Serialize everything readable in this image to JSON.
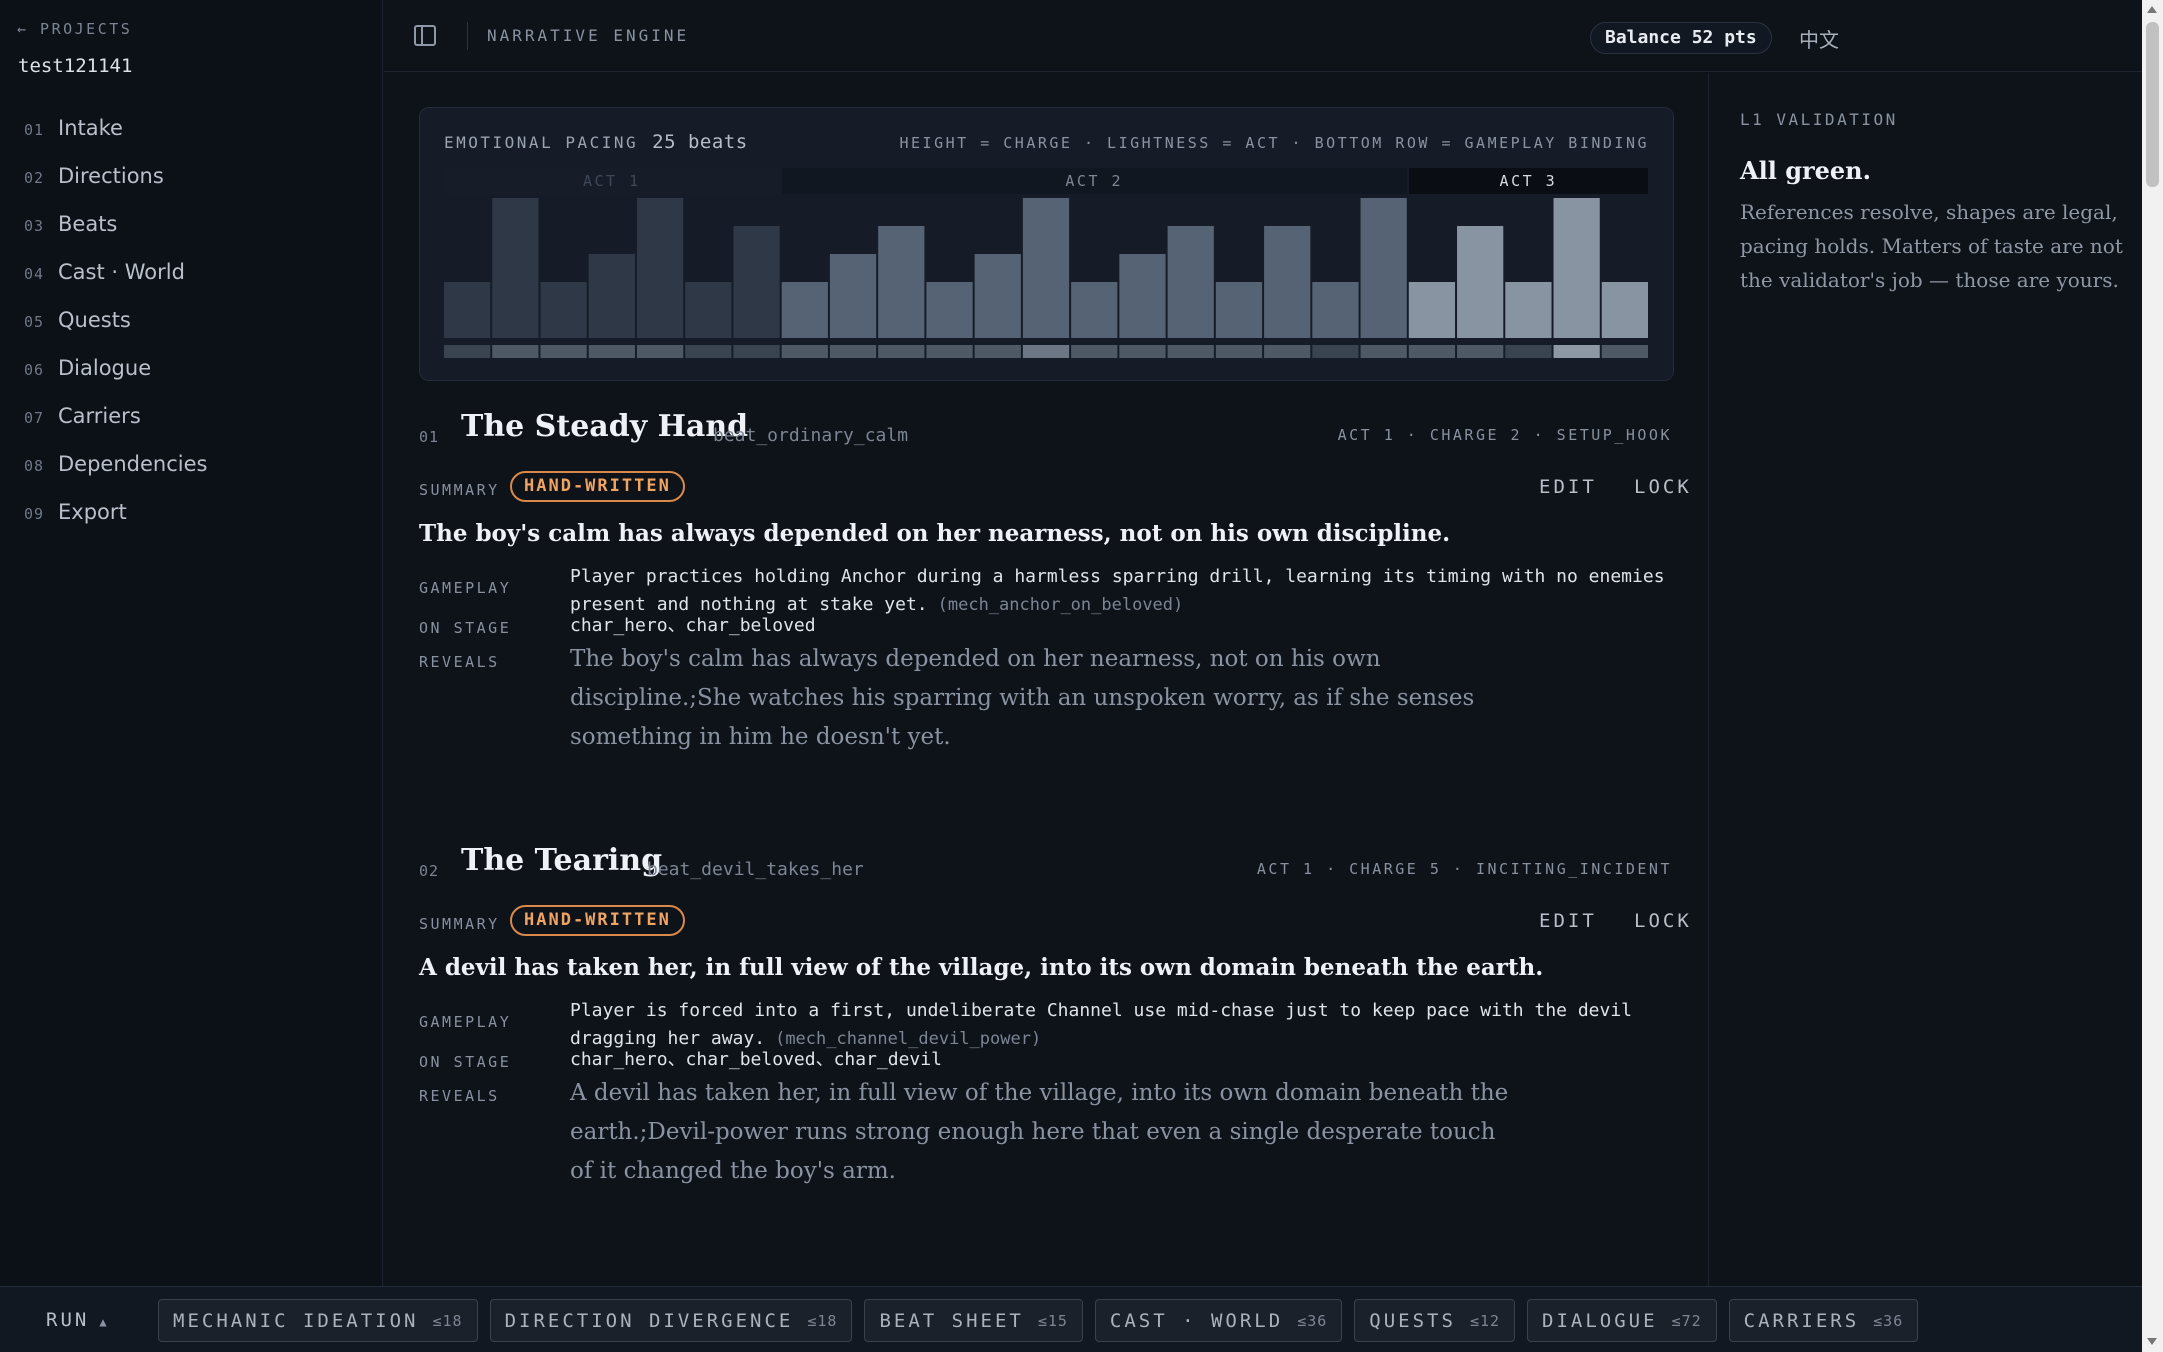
{
  "sidebar": {
    "back_label": "← PROJECTS",
    "project_name": "test121141",
    "items": [
      {
        "num": "01",
        "label": "Intake"
      },
      {
        "num": "02",
        "label": "Directions"
      },
      {
        "num": "03",
        "label": "Beats"
      },
      {
        "num": "04",
        "label": "Cast · World"
      },
      {
        "num": "05",
        "label": "Quests"
      },
      {
        "num": "06",
        "label": "Dialogue"
      },
      {
        "num": "07",
        "label": "Carriers"
      },
      {
        "num": "08",
        "label": "Dependencies"
      },
      {
        "num": "09",
        "label": "Export"
      }
    ]
  },
  "topbar": {
    "app_title": "NARRATIVE ENGINE",
    "balance": "Balance 52 pts",
    "lang_label": "中文"
  },
  "pacing": {
    "title": "EMOTIONAL PACING",
    "count": "25 beats",
    "legend": "HEIGHT = CHARGE · LIGHTNESS = ACT · BOTTOM ROW = GAMEPLAY BINDING",
    "acts": [
      {
        "label": "ACT 1",
        "beats": 7,
        "text_color": "#3f4857",
        "bg": "#161d28"
      },
      {
        "label": "ACT 2",
        "beats": 13,
        "text_color": "#7d8695",
        "bg": "#111720"
      },
      {
        "label": "ACT 3",
        "beats": 5,
        "text_color": "#d6dbe3",
        "bg": "#0a0e14"
      }
    ],
    "charges": [
      2,
      5,
      2,
      3,
      5,
      2,
      4,
      2,
      3,
      4,
      2,
      3,
      5,
      2,
      3,
      4,
      2,
      4,
      2,
      5,
      2,
      4,
      2,
      5,
      2
    ],
    "max_charge": 5,
    "bar_colors": {
      "act1": "#2e3846",
      "act2": "#566374",
      "act3": "#8994a3"
    },
    "binding_colors": [
      "#3a4350",
      "#4f5966",
      "#4f5966",
      "#4f5966",
      "#4f5966",
      "#3a4350",
      "#3a4350",
      "#4f5966",
      "#4f5966",
      "#4f5966",
      "#4f5966",
      "#4f5966",
      "#6c7684",
      "#4f5966",
      "#4f5966",
      "#4f5966",
      "#4f5966",
      "#4f5966",
      "#3a4350",
      "#4f5966",
      "#4f5966",
      "#4f5966",
      "#3a4350",
      "#8e97a4",
      "#4f5966"
    ]
  },
  "beats": [
    {
      "num": "01",
      "title": "The Steady Hand",
      "id": "beat_ordinary_calm",
      "meta": "ACT 1 · CHARGE 2 · SETUP_HOOK",
      "summary_label": "SUMMARY",
      "badge": "HAND-WRITTEN",
      "edit": "EDIT",
      "lock": "LOCK",
      "summary": "The boy's calm has always depended on her nearness, not on his own discipline.",
      "gameplay_label": "GAMEPLAY",
      "gameplay": "Player practices holding Anchor during a harmless sparring drill, learning its timing with no enemies present and nothing at stake yet.",
      "mech": "(mech_anchor_on_beloved)",
      "on_stage_label": "ON STAGE",
      "on_stage": "char_hero、char_beloved",
      "reveals_label": "REVEALS",
      "reveals": "The boy's calm has always depended on her nearness, not on his own discipline.;She watches his sparring with an unspoken worry, as if she senses something in him he doesn't yet."
    },
    {
      "num": "02",
      "title": "The Tearing",
      "id": "beat_devil_takes_her",
      "meta": "ACT 1 · CHARGE 5 · INCITING_INCIDENT",
      "summary_label": "SUMMARY",
      "badge": "HAND-WRITTEN",
      "edit": "EDIT",
      "lock": "LOCK",
      "summary": "A devil has taken her, in full view of the village, into its own domain beneath the earth.",
      "gameplay_label": "GAMEPLAY",
      "gameplay": "Player is forced into a first, undeliberate Channel use mid-chase just to keep pace with the devil dragging her away.",
      "mech": "(mech_channel_devil_power)",
      "on_stage_label": "ON STAGE",
      "on_stage": "char_hero、char_beloved、char_devil",
      "reveals_label": "REVEALS",
      "reveals": "A devil has taken her, in full view of the village, into its own domain beneath the earth.;Devil-power runs strong enough here that even a single desperate touch of it changed the boy's arm."
    }
  ],
  "validation": {
    "label": "L1 VALIDATION",
    "headline": "All green.",
    "body": "References resolve, shapes are legal, pacing holds. Matters of taste are not the validator's job — those are yours."
  },
  "bottombar": {
    "run_label": "RUN",
    "run_caret": "▲",
    "stages": [
      {
        "name": "MECHANIC IDEATION",
        "limit": "≤18"
      },
      {
        "name": "DIRECTION DIVERGENCE",
        "limit": "≤18"
      },
      {
        "name": "BEAT SHEET",
        "limit": "≤15"
      },
      {
        "name": "CAST · WORLD",
        "limit": "≤36"
      },
      {
        "name": "QUESTS",
        "limit": "≤12"
      },
      {
        "name": "DIALOGUE",
        "limit": "≤72"
      },
      {
        "name": "CARRIERS",
        "limit": "≤36"
      }
    ]
  }
}
